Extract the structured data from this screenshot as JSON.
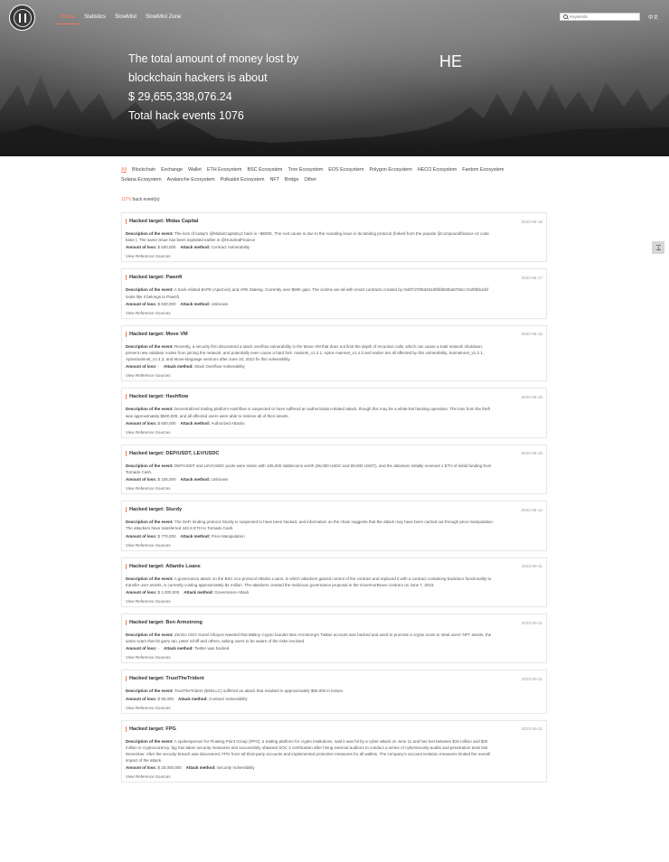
{
  "nav": {
    "items": [
      "Home",
      "Statistics",
      "SlowMist",
      "SlowMist Zone"
    ],
    "active": "Home",
    "search_placeholder": "Keywords",
    "lang": "中文"
  },
  "hero": {
    "line1": "The total amount of money lost by",
    "line2": "blockchain hackers is about",
    "amount": "$ 29,655,338,076.24",
    "events": "Total hack events 1076",
    "side": "HE"
  },
  "filters": [
    "All",
    "Blockchain",
    "Exchange",
    "Wallet",
    "ETH Ecosystem",
    "BSC Ecosystem",
    "Tron Ecosystem",
    "EOS Ecosystem",
    "Polygon Ecosystem",
    "HECO Ecosystem",
    "Fantom Ecosystem",
    "Solana Ecosystem",
    "Avalanche Ecosystem",
    "Polkadot Ecosystem",
    "NFT",
    "Bridge",
    "Other"
  ],
  "count": {
    "number": "1076",
    "label": " hack event(s)"
  },
  "labels": {
    "description": "Description of the event:",
    "amount": "Amount of loss:",
    "method": "Attack method:",
    "ref": "View Reference Sources"
  },
  "events": [
    {
      "title": "Hacked target: Midas Capital",
      "date": "2023-06-18",
      "desc": [
        " The loss of today's @MidasCapitalxyz hack is ~$600K. The root cause is due to the rounding issue in its landing protocol (forked from the popular @compoundfinance v2 code",
        "base ). The same issue has been exploited earlier in @HundredFinance"
      ],
      "amount": "$ 600,000",
      "method": "Contract Vulnerability"
    },
    {
      "title": "Hacked target: Pawnfi",
      "date": "2023-06-17",
      "desc": [
        " A hack related $APE (ApeCoin) and APE Staking. Currently over $50K gain. The victims are all with smart contracts created by 0x8f7370f5d4615f9fdb93ba0756cc7e2f8b51dcf",
        "looks like it belongs to Pawnfi."
      ],
      "amount": "$ 630,000",
      "method": "Unknown"
    },
    {
      "title": "Hacked target: Move VM",
      "date": "2023-06-15",
      "desc": [
        " Recently, a security firm discovered a stack overflow vulnerability in the Move VM that does not limit the depth of recursive calls, which can cause a total network shutdown,",
        "prevent new validator nodes from joining the network, and potentially even cause a hard fork. mainnet_v1.2.1, Aptos mainnet_v1.4.3 and earlier are all affected by this vulnerability, Suimainnet_v1.2.1,",
        "Aptosmainnet_v1.4.3, and Move-language versions after June 10, 2023 fix this vulnerability."
      ],
      "amount": "-",
      "method": "Stack Overflow Vulnerability"
    },
    {
      "title": "Hacked target: Hashflow",
      "date": "2023-06-15",
      "desc": [
        " Decentralized trading platform Hashflow is suspected to have suffered an authorization-related attack, though this may be a white-hat hacking operation. The loss from the theft",
        "was approximately $600,000, and all affected users were able to retrieve all of their assets."
      ],
      "amount": "$ 600,000",
      "method": "Authorized Attacks"
    },
    {
      "title": "Hacked target: DEP/USDT, LEV/USDC",
      "date": "2023-06-15",
      "desc": [
        " DEP/USDT and LEV/USDC pools were stolen with 105,000 stablecoins worth (36,000 USDC and 69,000 USDT), and the attackers initially received 1 ETH of initial funding from",
        "Tornado Cash."
      ],
      "amount": "$ 105,000",
      "method": "Unknown"
    },
    {
      "title": "Hacked target: Sturdy",
      "date": "2023-06-12",
      "desc": [
        " The DeFi lending protocol Sturdy is suspected to have been hacked, and information on the chain suggests that the attack may have been carried out through price manipulation.",
        "The attackers have transferred 442.6 ETH to Tornado Cash."
      ],
      "amount": "$ 770,000",
      "method": "Price Manipulation"
    },
    {
      "title": "Hacked target: Atlantis Loans",
      "date": "2023-06-11",
      "desc": [
        " A governance attack on the BSC eco-protocol Atlantis Loans, in which attackers gained control of the contract and replaced it with a contract containing backdoor functionality to",
        "transfer user assets, is currently costing approximately $1 million. The attackers created the malicious governance proposal in the GovernorBravo contract on June 7, 2023."
      ],
      "amount": "$ 1,000,000",
      "method": "Governance Attack"
    },
    {
      "title": "Hacked target: Ben Armstrong",
      "date": "2023-06-11",
      "desc": [
        " ZenGo CEO Ouriel Ohayon tweeted that BitBoy Crypto founder Ben Armstrong's Twitter account was hacked and used to promote a crypto scam to steal users' NFT assets, the",
        "same scam that hit garry tan, peter schiff and others, asking users to be aware of the risks involved."
      ],
      "amount": "-",
      "method": "Twitter was hacked"
    },
    {
      "title": "Hacked target: TrustTheTrident",
      "date": "2023-06-11",
      "desc": [
        " TrustTheTrident ($SELLC) suffered an attack that resulted in approximately $95,000 in losses."
      ],
      "amount": "$ 95,000",
      "method": "Contract Vulnerability"
    },
    {
      "title": "Hacked target: FPG",
      "date": "2023-06-11",
      "desc": [
        " A spokesperson for Floating Point Group (FPG), a trading platform for crypto institutions, said it was hit by a cyber attack on June 11 and has lost between $15 million and $20",
        "million in cryptocurrency. fpg has taken security measures and successfully obtained SOC 2 certification after hiring external auditors to conduct a series of cybersecurity audits and penetration tests last",
        "December. After the security breach was discovered, FPG froze all third-party accounts and implemented protective measures for all wallets. The company's account isolation measures limited the overall",
        "impact of the attack."
      ],
      "amount": "$ 20,000,000",
      "method": "Security Vulnerability"
    }
  ],
  "colors": {
    "accent": "#f07a5a",
    "hero_dark": "#2a2a2a"
  }
}
